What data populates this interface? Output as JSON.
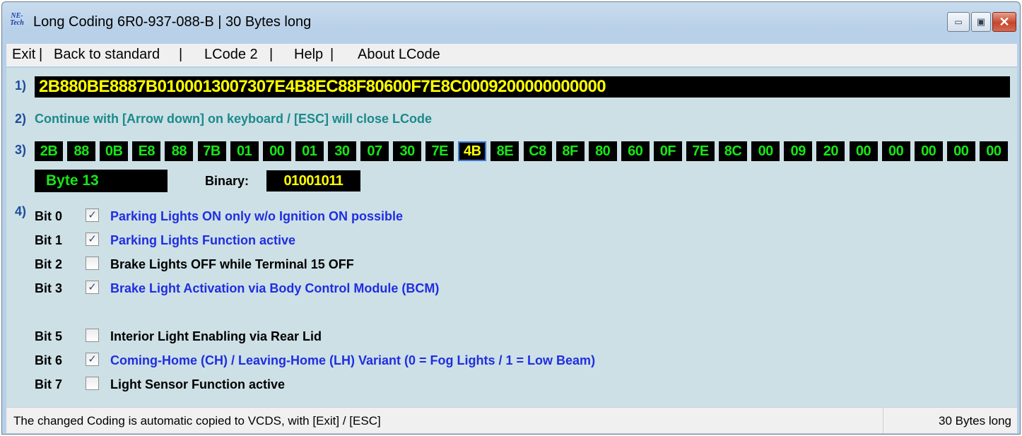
{
  "window": {
    "icon_text_1": "NE-",
    "icon_text_2": "Tech",
    "title": "Long Coding  6R0-937-088-B | 30 Bytes long",
    "minimize_glyph": "▭",
    "maximize_glyph": "▣",
    "close_glyph": "✕"
  },
  "menu": {
    "items": [
      "Exit",
      "Back to standard",
      "LCode 2",
      "Help",
      "About LCode"
    ],
    "separator": "|"
  },
  "steps": {
    "s1": "1)",
    "s2": "2)",
    "s3": "3)",
    "s4": "4)"
  },
  "coding": "2B880BE8887B0100013007307E4B8EC88F80600F7E8C0009200000000000",
  "hint": "Continue with [Arrow down] on keyboard / [ESC] will close LCode",
  "bytes": [
    "2B",
    "88",
    "0B",
    "E8",
    "88",
    "7B",
    "01",
    "00",
    "01",
    "30",
    "07",
    "30",
    "7E",
    "4B",
    "8E",
    "C8",
    "8F",
    "80",
    "60",
    "0F",
    "7E",
    "8C",
    "00",
    "09",
    "20",
    "00",
    "00",
    "00",
    "00",
    "00"
  ],
  "selected_byte_index": 13,
  "byte_label": "Byte 13",
  "binary_label": "Binary:",
  "binary_value": "01001011",
  "bits": [
    {
      "label": "Bit 0",
      "checked": true,
      "desc": "Parking Lights ON only w/o Ignition ON possible"
    },
    {
      "label": "Bit 1",
      "checked": true,
      "desc": "Parking Lights Function active"
    },
    {
      "label": "Bit 2",
      "checked": false,
      "desc": "Brake Lights OFF while Terminal 15 OFF"
    },
    {
      "label": "Bit 3",
      "checked": true,
      "desc": "Brake Light Activation via Body Control Module (BCM)"
    },
    {
      "label": "Bit 5",
      "checked": false,
      "desc": "Interior Light Enabling via Rear Lid"
    },
    {
      "label": "Bit 6",
      "checked": true,
      "desc": "Coming-Home (CH) / Leaving-Home (LH) Variant (0 = Fog Lights / 1 = Low Beam)"
    },
    {
      "label": "Bit 7",
      "checked": false,
      "desc": "Light Sensor Function active"
    }
  ],
  "colors": {
    "checked_text": "#1f2ee0",
    "unchecked_text": "#000000",
    "checkmark": "✓"
  },
  "status": {
    "message": "The changed Coding is automatic copied to VCDS, with [Exit] / [ESC]",
    "size": "30 Bytes long"
  }
}
